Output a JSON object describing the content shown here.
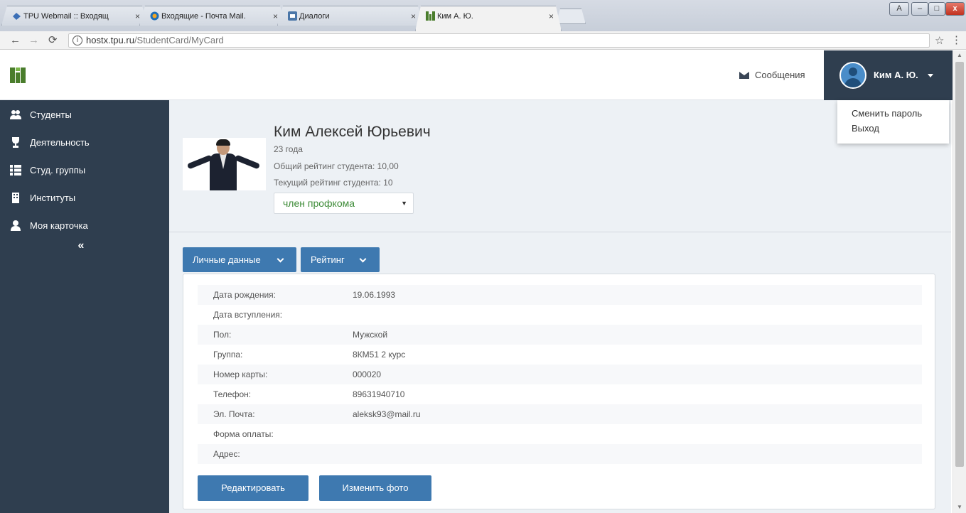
{
  "browser": {
    "tabs": [
      {
        "title": "TPU Webmail :: Входящ",
        "close": "×"
      },
      {
        "title": "Входящие - Почта Mail.",
        "close": "×"
      },
      {
        "title": "Диалоги",
        "close": "×"
      },
      {
        "title": "Ким А. Ю.",
        "close": "×"
      }
    ],
    "url_host": "hostx.tpu.ru",
    "url_path": "/StudentCard/MyCard",
    "window_controls": {
      "user": "A",
      "minimize": "–",
      "maximize": "□",
      "close": "x"
    }
  },
  "header": {
    "messages_label": "Сообщения",
    "user_name": "Ким А. Ю."
  },
  "user_dropdown": {
    "items": [
      "Сменить пароль",
      "Выход"
    ]
  },
  "sidebar": {
    "items": [
      {
        "label": "Студенты",
        "icon": "users-icon"
      },
      {
        "label": "Деятельность",
        "icon": "trophy-icon"
      },
      {
        "label": "Студ. группы",
        "icon": "list-icon"
      },
      {
        "label": "Институты",
        "icon": "building-icon"
      },
      {
        "label": "Моя карточка",
        "icon": "user-icon"
      }
    ],
    "collapse": "«"
  },
  "profile": {
    "full_name": "Ким Алексей Юрьевич",
    "age": "23 года",
    "rating_total": "Общий рейтинг студента: 10,00",
    "rating_current": "Текущий рейтинг студента: 10",
    "status": "член профкома"
  },
  "tabs": {
    "personal": "Личные данные",
    "rating": "Рейтинг"
  },
  "details": [
    {
      "label": "Дата рождения:",
      "value": "19.06.1993"
    },
    {
      "label": "Дата вступления:",
      "value": ""
    },
    {
      "label": "Пол:",
      "value": "Мужской"
    },
    {
      "label": "Группа:",
      "value": "8КМ51 2 курс"
    },
    {
      "label": "Номер карты:",
      "value": "000020"
    },
    {
      "label": "Телефон:",
      "value": "89631940710"
    },
    {
      "label": "Эл. Почта:",
      "value": "aleksk93@mail.ru"
    },
    {
      "label": "Форма оплаты:",
      "value": ""
    },
    {
      "label": "Адрес:",
      "value": ""
    }
  ],
  "actions": {
    "edit": "Редактировать",
    "change_photo": "Изменить фото"
  },
  "colors": {
    "sidebar_bg": "#2f3e4f",
    "primary": "#3e79b0",
    "status_text": "#3d8b37"
  }
}
